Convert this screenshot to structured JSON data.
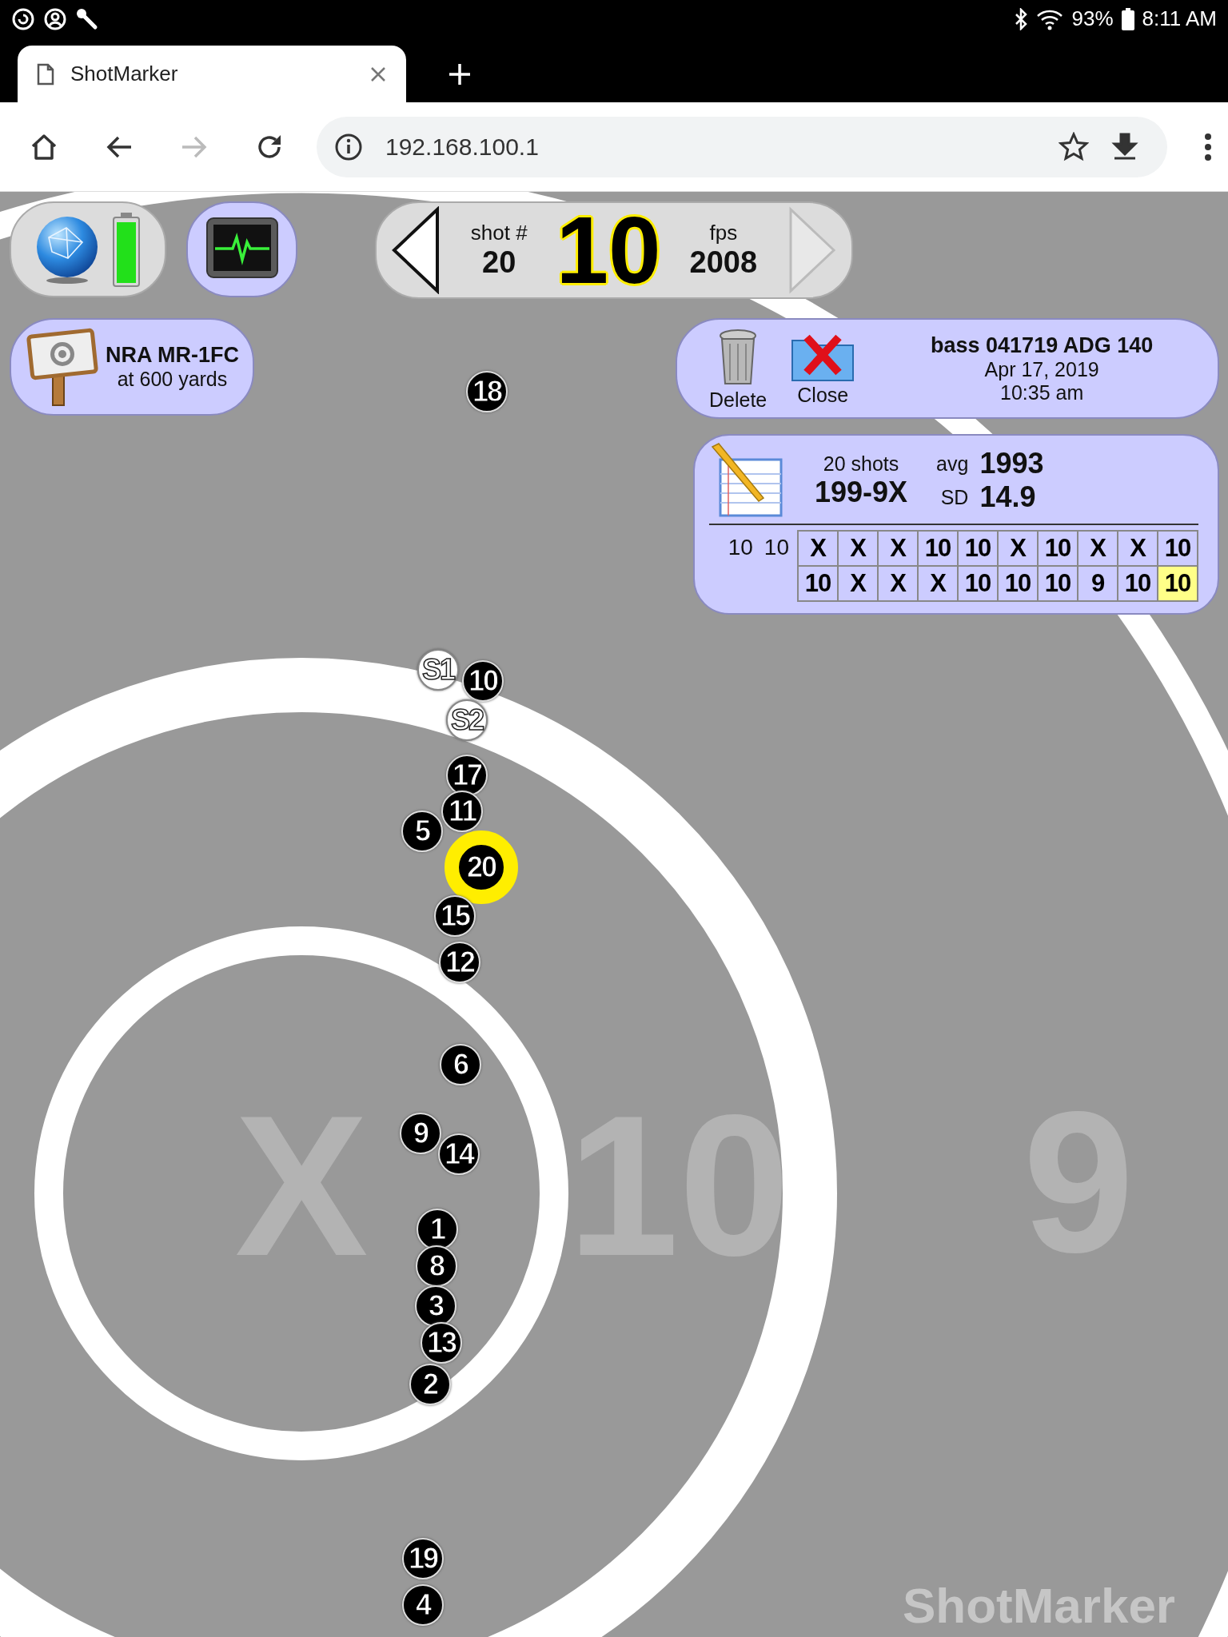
{
  "status_bar": {
    "battery": "93%",
    "time": "8:11 AM"
  },
  "browser": {
    "tabs": [
      {
        "title": "ShotMarker",
        "selected": true
      }
    ],
    "url": "192.168.100.1"
  },
  "shot_nav": {
    "shot_label": "shot #",
    "shot_number": "20",
    "score": "10",
    "fps_label": "fps",
    "fps": "2008"
  },
  "target_info": {
    "name": "NRA MR-1FC",
    "distance": "at 600 yards"
  },
  "session": {
    "delete_label": "Delete",
    "close_label": "Close",
    "title": "bass 041719 ADG 140",
    "date": "Apr 17, 2019",
    "time": "10:35 am"
  },
  "stats": {
    "shots": "20 shots",
    "score": "199-9X",
    "avg_label": "avg",
    "avg": "1993",
    "sd_label": "SD",
    "sd": "14.9",
    "sighters": [
      "10",
      "10"
    ],
    "scores": [
      {
        "value": "X",
        "selected": false
      },
      {
        "value": "X",
        "selected": false
      },
      {
        "value": "X",
        "selected": false
      },
      {
        "value": "10",
        "selected": false
      },
      {
        "value": "10",
        "selected": false
      },
      {
        "value": "X",
        "selected": false
      },
      {
        "value": "10",
        "selected": false
      },
      {
        "value": "X",
        "selected": false
      },
      {
        "value": "X",
        "selected": false
      },
      {
        "value": "10",
        "selected": false
      },
      {
        "value": "10",
        "selected": false
      },
      {
        "value": "X",
        "selected": false
      },
      {
        "value": "X",
        "selected": false
      },
      {
        "value": "X",
        "selected": false
      },
      {
        "value": "10",
        "selected": false
      },
      {
        "value": "10",
        "selected": false
      },
      {
        "value": "10",
        "selected": false
      },
      {
        "value": "9",
        "selected": false
      },
      {
        "value": "10",
        "selected": false
      },
      {
        "value": "10",
        "selected": true
      }
    ]
  },
  "target": {
    "ring_labels": [
      "X",
      "10",
      "9"
    ],
    "shots": [
      {
        "label": "18",
        "kind": "record",
        "selected": false
      },
      {
        "label": "S1",
        "kind": "sighter",
        "selected": false
      },
      {
        "label": "10",
        "kind": "record",
        "selected": false
      },
      {
        "label": "S2",
        "kind": "sighter",
        "selected": false
      },
      {
        "label": "17",
        "kind": "record",
        "selected": false
      },
      {
        "label": "11",
        "kind": "record",
        "selected": false
      },
      {
        "label": "5",
        "kind": "record",
        "selected": false
      },
      {
        "label": "20",
        "kind": "record",
        "selected": true
      },
      {
        "label": "15",
        "kind": "record",
        "selected": false
      },
      {
        "label": "12",
        "kind": "record",
        "selected": false
      },
      {
        "label": "6",
        "kind": "record",
        "selected": false
      },
      {
        "label": "9",
        "kind": "record",
        "selected": false
      },
      {
        "label": "14",
        "kind": "record",
        "selected": false
      },
      {
        "label": "1",
        "kind": "record",
        "selected": false
      },
      {
        "label": "8",
        "kind": "record",
        "selected": false
      },
      {
        "label": "3",
        "kind": "record",
        "selected": false
      },
      {
        "label": "13",
        "kind": "record",
        "selected": false
      },
      {
        "label": "2",
        "kind": "record",
        "selected": false
      },
      {
        "label": "19",
        "kind": "record",
        "selected": false
      },
      {
        "label": "4",
        "kind": "record",
        "selected": false
      }
    ]
  },
  "logo": "ShotMarker"
}
